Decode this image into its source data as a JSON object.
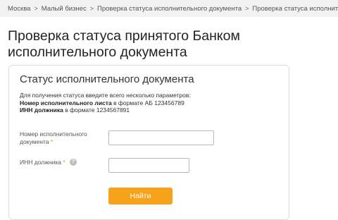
{
  "breadcrumb": {
    "items": [
      "Москва",
      "Малый бизнес",
      "Проверка статуса исполнительного документа",
      "Проверка статуса исполнительного документа"
    ],
    "separator": ">"
  },
  "page": {
    "title_line1": "Проверка статуса принятого Банком",
    "title_line2": "исполнительного документа"
  },
  "card": {
    "title": "Статус исполнительного документа",
    "intro": "Для получения статуса введите всего несколько параметров:",
    "param1_name": "Номер исполнительного листа",
    "param1_format": " в формате АБ 123456789",
    "param2_name": "ИНН должника",
    "param2_format": " в формате 1234567891"
  },
  "form": {
    "doc_number": {
      "label_line1": "Номер исполнительного",
      "label_line2": "документа",
      "required_mark": "*",
      "value": ""
    },
    "inn": {
      "label": "ИНН должника",
      "required_mark": "*",
      "help_glyph": "?",
      "value": ""
    },
    "submit_label": "Найти"
  },
  "colors": {
    "accent": "#f7a21b",
    "required": "#f08c00",
    "breadcrumb_bg": "#f2f2f2"
  }
}
